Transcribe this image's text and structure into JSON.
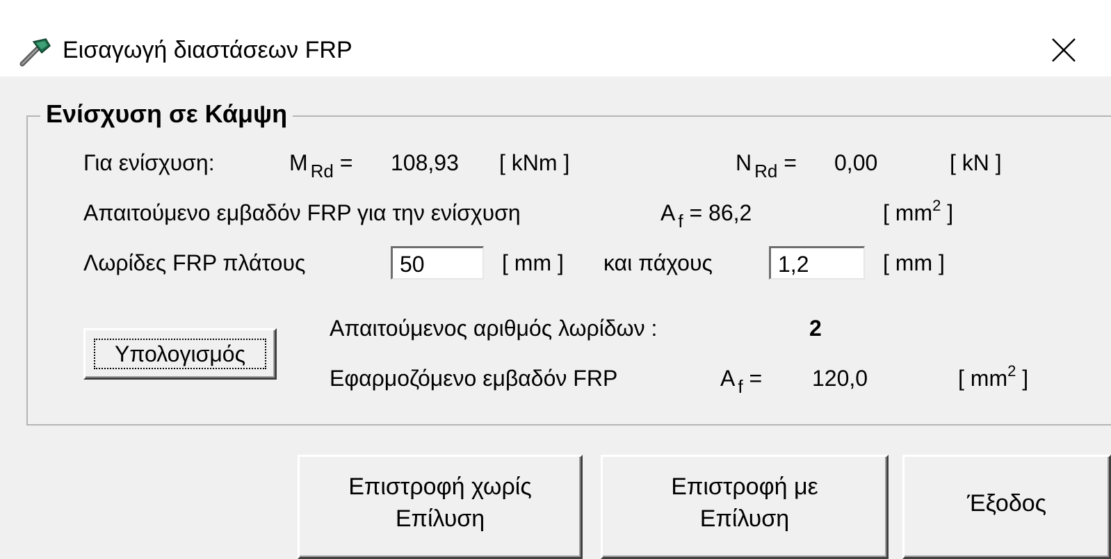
{
  "window": {
    "title": "Εισαγωγή διαστάσεων FRP",
    "close_glyph": "✕",
    "icon": "tool-icon",
    "close_icon": "close-icon"
  },
  "group": {
    "title": "Ενίσχυση σε Κάμψη",
    "row1": {
      "label": "Για ενίσχυση:",
      "m_symbol": "M",
      "m_sub": "Rd",
      "m_eq": "=",
      "m_value": "108,93",
      "m_unit": "[ kNm ]",
      "n_symbol": "N",
      "n_sub": "Rd",
      "n_eq": "=",
      "n_value": "0,00",
      "n_unit": "[ kN ]"
    },
    "row2": {
      "label": "Απαιτούμενο εμβαδόν FRP για την ενίσχυση",
      "a_symbol": "A",
      "a_sub": "f",
      "a_eq_value": "= 86,2",
      "unit_open": "[ mm",
      "unit_sup": "2",
      "unit_close": " ]"
    },
    "row3": {
      "label": "Λωρίδες FRP πλάτους",
      "width_value": "50",
      "width_unit": "[ mm ]",
      "thickness_label": "και πάχους",
      "thickness_value": "1,2",
      "thickness_unit": "[ mm ]"
    },
    "calc_button": "Υπολογισμός",
    "result1": {
      "label": "Απαιτούμενος αριθμός λωρίδων :",
      "value": "2"
    },
    "result2": {
      "label": "Εφαρμοζόμενο εμβαδόν FRP",
      "a_symbol": "A",
      "a_sub": "f",
      "a_eq": "=",
      "value": "120,0",
      "unit_open": "[ mm",
      "unit_sup": "2",
      "unit_close": " ]"
    }
  },
  "buttons": {
    "return_without_line1": "Επιστροφή χωρίς",
    "return_without_line2": "Επίλυση",
    "return_with_line1": "Επιστροφή με",
    "return_with_line2": "Επίλυση",
    "exit": "Έξοδος"
  }
}
